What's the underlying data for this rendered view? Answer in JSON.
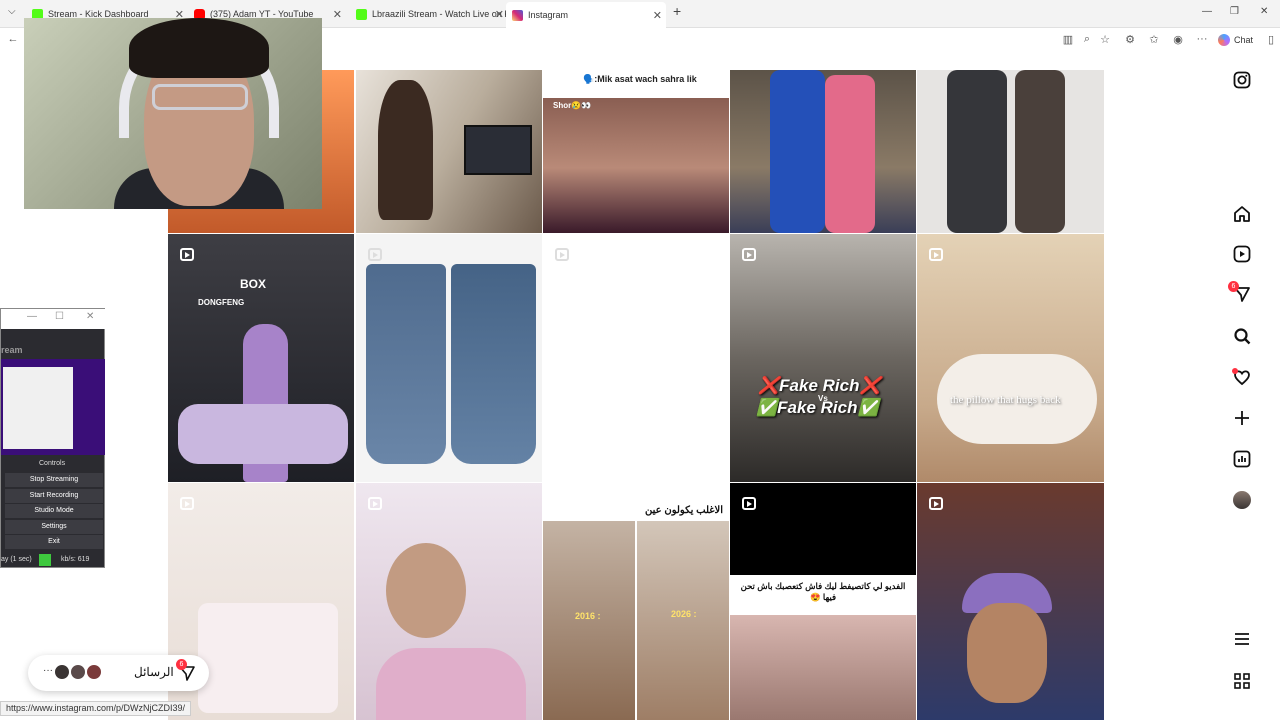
{
  "browser": {
    "tabs": [
      {
        "title": "Stream - Kick Dashboard",
        "color": "#53fc18"
      },
      {
        "title": "(375) Adam YT - YouTube",
        "color": "#ff0000"
      },
      {
        "title": "Lbraazili Stream - Watch Live on K",
        "color": "#53fc18"
      },
      {
        "title": "Instagram",
        "color": "#d62976"
      }
    ],
    "new_tab": "+",
    "chat_label": "Chat",
    "status_url": "https://www.instagram.com/p/DWzNjCZDI39/"
  },
  "posts": [
    {
      "overlay": ""
    },
    {
      "overlay": ""
    },
    {
      "overlay": "🗣️:Mik asat wach sahra lik",
      "sub": "Shor😢👀"
    },
    {
      "overlay": ""
    },
    {
      "overlay": ""
    },
    {
      "overlay": "BOX",
      "sub": "DONGFENG"
    },
    {
      "overlay": ""
    },
    {
      "overlay": ""
    },
    {
      "overlay": "❌Fake Rich❌",
      "sub": "✅Fake Rich✅",
      "vs": "Vs"
    },
    {
      "overlay": "the pillow that hugs back"
    },
    {
      "overlay": ""
    },
    {
      "overlay": ""
    },
    {
      "overlay": "الاغلب يكولون عين",
      "sub": "2016 :",
      "sub2": "2026 :"
    },
    {
      "overlay": "الفديو لي كاتصيفط ليك فاش كتعصبك باش تحن فيها 😍"
    },
    {
      "overlay": ""
    }
  ],
  "obs": {
    "title": "ream",
    "controls_label": "Controls",
    "buttons": [
      "Stop Streaming",
      "Start Recording",
      "Studio Mode",
      "Settings",
      "Exit"
    ],
    "status_left": "ay (1 sec)",
    "status_right": "kb/s: 619"
  },
  "sidebar": {
    "notifications_badge": "6"
  },
  "messages": {
    "label": "الرسائل",
    "badge": "6",
    "more": "···"
  }
}
